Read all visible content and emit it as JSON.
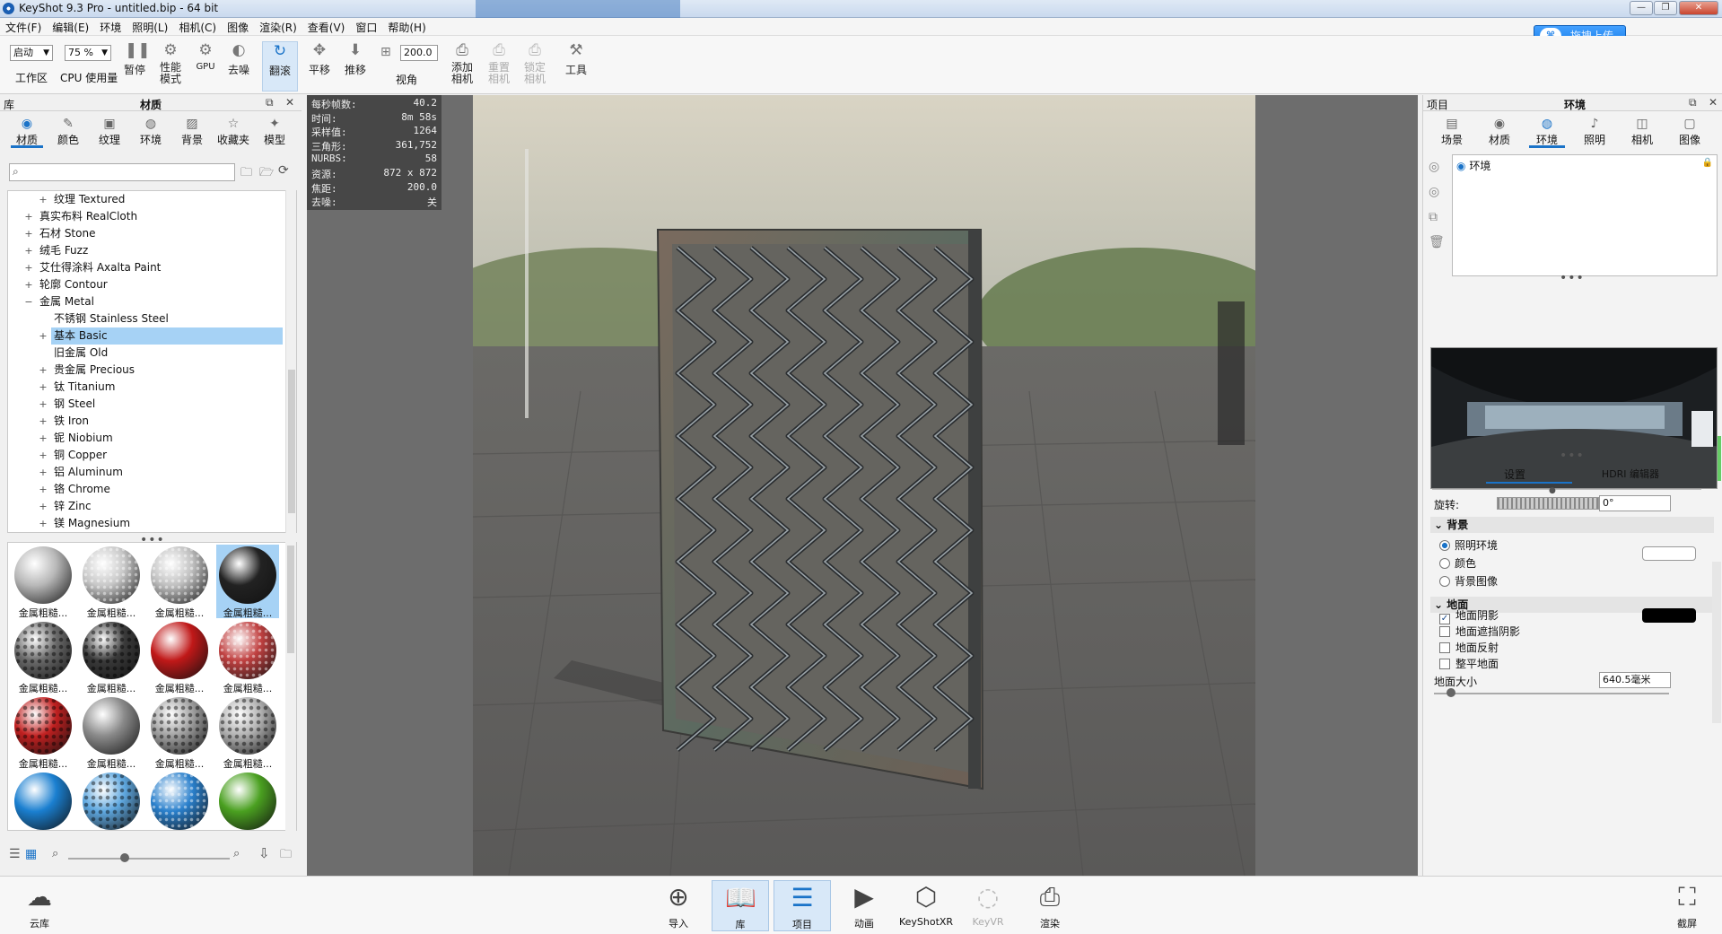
{
  "window": {
    "title": "KeyShot 9.3 Pro  - untitled.bip  - 64 bit",
    "upload_label": "拖拽上传"
  },
  "menu": [
    "文件(F)",
    "编辑(E)",
    "环境",
    "照明(L)",
    "相机(C)",
    "图像",
    "渲染(R)",
    "查看(V)",
    "窗口",
    "帮助(H)"
  ],
  "toolbar": {
    "workspace_value": "启动",
    "workspace_label": "工作区",
    "cpu_value": "75 %",
    "cpu_label": "CPU 使用量",
    "pause_label": "暂停",
    "perf_label1": "性能",
    "perf_label2": "模式",
    "gpu_label": "GPU",
    "denoise_label": "去噪",
    "tumble_label": "翻滚",
    "pan_label": "平移",
    "dolly_label": "推移",
    "fov_value": "200.0",
    "fov_label": "视角",
    "add_cam_1": "添加",
    "add_cam_2": "相机",
    "reset_cam_1": "重置",
    "reset_cam_2": "相机",
    "lock_cam_1": "锁定",
    "lock_cam_2": "相机",
    "tools_label": "工具"
  },
  "library": {
    "header_left": "库",
    "header_title": "材质",
    "tabs": [
      "材质",
      "颜色",
      "纹理",
      "环境",
      "背景",
      "收藏夹",
      "模型"
    ],
    "tree": [
      {
        "label": "纹理 Textured",
        "indent": 2,
        "pm": "+"
      },
      {
        "label": "真实布料 RealCloth",
        "indent": 1,
        "pm": "+"
      },
      {
        "label": "石材 Stone",
        "indent": 1,
        "pm": "+"
      },
      {
        "label": "绒毛 Fuzz",
        "indent": 1,
        "pm": "+"
      },
      {
        "label": "艾仕得涂料 Axalta Paint",
        "indent": 1,
        "pm": "+"
      },
      {
        "label": "轮廓 Contour",
        "indent": 1,
        "pm": "+"
      },
      {
        "label": "金属 Metal",
        "indent": 1,
        "pm": "−"
      },
      {
        "label": "不锈钢 Stainless Steel",
        "indent": 2,
        "pm": ""
      },
      {
        "label": "基本 Basic",
        "indent": 2,
        "pm": "+",
        "selected": true
      },
      {
        "label": "旧金属 Old",
        "indent": 2,
        "pm": ""
      },
      {
        "label": "贵金属 Precious",
        "indent": 2,
        "pm": "+"
      },
      {
        "label": "钛 Titanium",
        "indent": 2,
        "pm": "+"
      },
      {
        "label": "钢 Steel",
        "indent": 2,
        "pm": "+"
      },
      {
        "label": "铁 Iron",
        "indent": 2,
        "pm": "+"
      },
      {
        "label": "铌 Niobium",
        "indent": 2,
        "pm": "+"
      },
      {
        "label": "铜 Copper",
        "indent": 2,
        "pm": "+"
      },
      {
        "label": "铝 Aluminum",
        "indent": 2,
        "pm": "+"
      },
      {
        "label": "铬 Chrome",
        "indent": 2,
        "pm": "+"
      },
      {
        "label": "锌 Zinc",
        "indent": 2,
        "pm": "+"
      },
      {
        "label": "镁 Magnesium",
        "indent": 2,
        "pm": "+"
      }
    ],
    "thumbs": [
      {
        "label": "金属粗糙...",
        "color": "#b8b8b8",
        "style": "swirl"
      },
      {
        "label": "金属粗糙...",
        "color": "#c8c8c8",
        "style": "dots"
      },
      {
        "label": "金属粗糙...",
        "color": "#c0c0c0",
        "style": "dots"
      },
      {
        "label": "金属粗糙...",
        "color": "#222222",
        "style": "swirl",
        "selected": true
      },
      {
        "label": "金属粗糙...",
        "color": "#6a6a6a",
        "style": "hex"
      },
      {
        "label": "金属粗糙...",
        "color": "#3a3a3a",
        "style": "hex"
      },
      {
        "label": "金属粗糙...",
        "color": "#c01818",
        "style": "swirl"
      },
      {
        "label": "金属粗糙...",
        "color": "#c04040",
        "style": "dots"
      },
      {
        "label": "金属粗糙...",
        "color": "#c02020",
        "style": "hex"
      },
      {
        "label": "金属粗糙...",
        "color": "#8a8a8a",
        "style": "swirl"
      },
      {
        "label": "金属粗糙...",
        "color": "#a0a0a0",
        "style": "hex"
      },
      {
        "label": "金属粗糙...",
        "color": "#b0b0b0",
        "style": "hex"
      },
      {
        "label": "金属粗糙...",
        "color": "#1a7fd0",
        "style": "swirl"
      },
      {
        "label": "金属粗糙...",
        "color": "#5fa8e0",
        "style": "hex"
      },
      {
        "label": "金属粗糙...",
        "color": "#2a80cc",
        "style": "dots"
      },
      {
        "label": "金属粗糙...",
        "color": "#4aa020",
        "style": "swirl"
      }
    ]
  },
  "hud": [
    {
      "k": "每秒帧数:",
      "v": "40.2"
    },
    {
      "k": "时间:",
      "v": "8m 58s"
    },
    {
      "k": "采样值:",
      "v": "1264"
    },
    {
      "k": "三角形:",
      "v": "361,752"
    },
    {
      "k": "NURBS:",
      "v": "58"
    },
    {
      "k": "资源:",
      "v": "872 x 872"
    },
    {
      "k": "焦距:",
      "v": "200.0"
    },
    {
      "k": "去噪:",
      "v": "关"
    }
  ],
  "project": {
    "header_left": "项目",
    "header_title": "环境",
    "tabs": [
      "场景",
      "材质",
      "环境",
      "照明",
      "相机",
      "图像"
    ],
    "env_item": "环境",
    "subtabs": [
      "设置",
      "HDRI 编辑器"
    ],
    "rotation_label": "旋转:",
    "rotation_value": "0°",
    "background_section": "背景",
    "bg_options": [
      {
        "label": "照明环境",
        "on": true
      },
      {
        "label": "颜色",
        "on": false
      },
      {
        "label": "背景图像",
        "on": false
      }
    ],
    "ground_section": "地面",
    "ground_options": [
      {
        "label": "地面阴影",
        "on": true
      },
      {
        "label": "地面遮挡阴影",
        "on": false
      },
      {
        "label": "地面反射",
        "on": false
      },
      {
        "label": "整平地面",
        "on": false
      }
    ],
    "ground_size_label": "地面大小",
    "ground_size_value": "640.5毫米"
  },
  "bottom": {
    "cloud_label": "云库",
    "buttons": [
      {
        "label": "导入",
        "icon": "import-icon"
      },
      {
        "label": "库",
        "icon": "library-icon",
        "on": true
      },
      {
        "label": "项目",
        "icon": "project-icon",
        "on": true
      },
      {
        "label": "动画",
        "icon": "animation-icon"
      },
      {
        "label": "KeyShotXR",
        "icon": "keyshotxr-icon"
      },
      {
        "label": "KeyVR",
        "icon": "keyvr-icon",
        "dim": true
      },
      {
        "label": "渲染",
        "icon": "render-icon"
      }
    ],
    "screenshot_label": "截屏"
  }
}
